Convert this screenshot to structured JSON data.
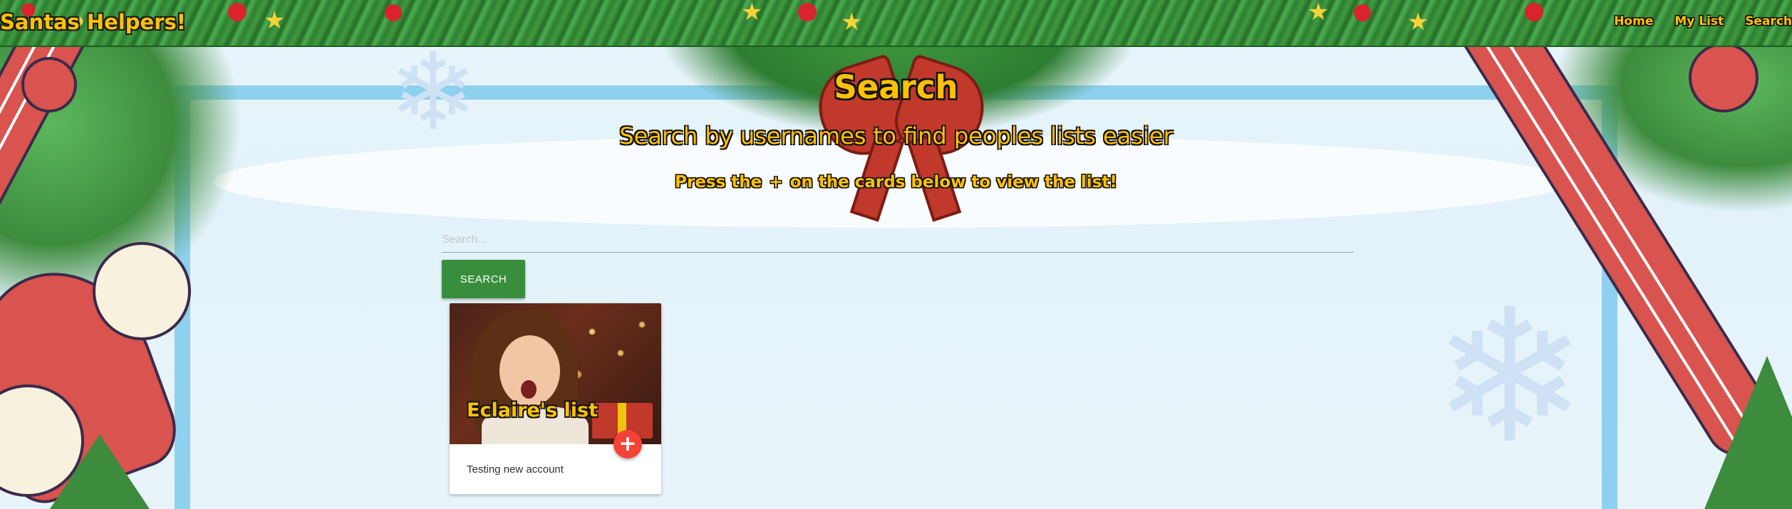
{
  "header": {
    "brand": "Santas Helpers!",
    "nav": [
      {
        "label": "Home"
      },
      {
        "label": "My List"
      },
      {
        "label": "Search"
      }
    ]
  },
  "main": {
    "title": "Search",
    "subtitle": "Search by usernames to find peoples lists easier",
    "hint_before": "Press the",
    "hint_plus": "+",
    "hint_after": "on the cards below to view the list!",
    "search": {
      "placeholder": "Search...",
      "value": "",
      "button_label": "SEARCH"
    },
    "cards": [
      {
        "title": "Eclaire's list",
        "description": "Testing new account",
        "action_icon": "plus-icon",
        "action_glyph": "+"
      }
    ]
  },
  "colors": {
    "accent_text": "#ffc107",
    "search_button": "#388e3c",
    "fab": "#f44336",
    "header_green": "#2e7d32"
  }
}
